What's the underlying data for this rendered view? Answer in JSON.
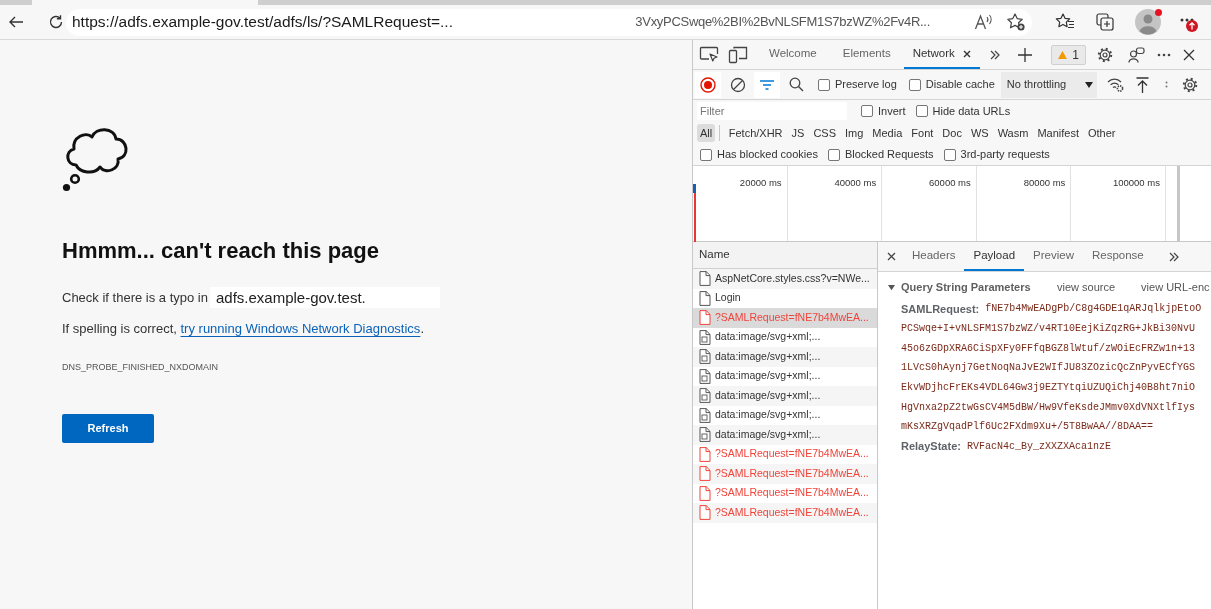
{
  "browser": {
    "url": "https://adfs.example-gov.test/adfs/ls/?SAMLRequest=...",
    "url_tail": "3VxyPCSwqe%2BI%2BvNLSFM1S7bzWZ%2Fv4R..."
  },
  "error_page": {
    "heading": "Hmmm... can't reach this page",
    "typo_hint": "Check if there is a typo in",
    "domain": "adfs.example-gov.test.",
    "spelling_hint": {
      "text": "If spelling is correct,",
      "link": "try running Windows Network Diagnostics",
      "end": "."
    },
    "error_code": "DNS_PROBE_FINISHED_NXDOMAIN",
    "refresh_button": "Refresh"
  },
  "devtools": {
    "tabs": [
      {
        "label": "Welcome",
        "selected": false
      },
      {
        "label": "Elements",
        "selected": false
      },
      {
        "label": "Network",
        "selected": true
      }
    ],
    "warning_count": "1",
    "toolbar": {
      "recording": true,
      "filter_bar_open": true,
      "checkboxes": [
        {
          "label": "Preserve log",
          "checked": false
        },
        {
          "label": "Disable cache",
          "checked": false
        }
      ],
      "throttling": "No throttling"
    },
    "filter": {
      "placeholder": "Filter",
      "options": [
        {
          "label": "Invert",
          "checked": false
        },
        {
          "label": "Hide data URLs",
          "checked": false
        }
      ]
    },
    "type_filters": [
      {
        "label": "All",
        "selected": true
      },
      {
        "label": "Fetch/XHR",
        "selected": false
      },
      {
        "label": "JS",
        "selected": false
      },
      {
        "label": "CSS",
        "selected": false
      },
      {
        "label": "Img",
        "selected": false
      },
      {
        "label": "Media",
        "selected": false
      },
      {
        "label": "Font",
        "selected": false
      },
      {
        "label": "Doc",
        "selected": false
      },
      {
        "label": "WS",
        "selected": false
      },
      {
        "label": "Wasm",
        "selected": false
      },
      {
        "label": "Manifest",
        "selected": false
      },
      {
        "label": "Other",
        "selected": false
      }
    ],
    "request_filters": [
      {
        "label": "Has blocked cookies",
        "checked": false
      },
      {
        "label": "Blocked Requests",
        "checked": false
      },
      {
        "label": "3rd-party requests",
        "checked": false
      }
    ],
    "timeline": {
      "ticks": [
        "20000 ms",
        "40000 ms",
        "60000 ms",
        "80000 ms",
        "100000 ms"
      ]
    },
    "requests": {
      "column": "Name",
      "rows": [
        {
          "name": "AspNetCore.styles.css?v=NWe...",
          "kind": "document",
          "failed": false,
          "selected": false
        },
        {
          "name": "Login",
          "kind": "document",
          "failed": false,
          "selected": false
        },
        {
          "name": "?SAMLRequest=fNE7b4MwEA...",
          "kind": "document",
          "failed": true,
          "selected": true
        },
        {
          "name": "data:image/svg+xml;...",
          "kind": "image",
          "failed": false,
          "selected": false
        },
        {
          "name": "data:image/svg+xml;...",
          "kind": "image",
          "failed": false,
          "selected": false
        },
        {
          "name": "data:image/svg+xml;...",
          "kind": "image",
          "failed": false,
          "selected": false
        },
        {
          "name": "data:image/svg+xml;...",
          "kind": "image",
          "failed": false,
          "selected": false
        },
        {
          "name": "data:image/svg+xml;...",
          "kind": "image",
          "failed": false,
          "selected": false
        },
        {
          "name": "data:image/svg+xml;...",
          "kind": "image",
          "failed": false,
          "selected": false
        },
        {
          "name": "?SAMLRequest=fNE7b4MwEA...",
          "kind": "document",
          "failed": true,
          "selected": false
        },
        {
          "name": "?SAMLRequest=fNE7b4MwEA...",
          "kind": "document",
          "failed": true,
          "selected": false
        },
        {
          "name": "?SAMLRequest=fNE7b4MwEA...",
          "kind": "document",
          "failed": true,
          "selected": false
        },
        {
          "name": "?SAMLRequest=fNE7b4MwEA...",
          "kind": "document",
          "failed": true,
          "selected": false
        }
      ]
    },
    "details": {
      "tabs": [
        {
          "label": "Headers",
          "selected": false
        },
        {
          "label": "Payload",
          "selected": true
        },
        {
          "label": "Preview",
          "selected": false
        },
        {
          "label": "Response",
          "selected": false
        }
      ],
      "section": {
        "title": "Query String Parameters",
        "expanded": true,
        "view_source": "view source",
        "view_url_encoded": "view URL-enc"
      },
      "params": [
        {
          "key": "SAMLRequest:",
          "lines": [
            "fNE7b4MwEADgPb/C8g4GDE1qARJqlkjpEtoO",
            "PCSwqe+I+vNLSFM1S7bzWZ/v4RT10EejKiZqzRG+JkBi30NvU",
            "45o6zGDpXRA6CiSpXFy0FFfqBGZ8lWtuf/zWOiEcFRZw1n+13",
            "1LVcS0hAynj7GetNoqNaJvE2WIfJU83ZOzicQcZnPyvECfYGS",
            "EkvWDjhcFrEKs4VDL64Gw3j9EZTYtqiUZUQiChj40B8ht7niO",
            "HgVnxa2pZ2twGsCV4M5dBW/Hw9VfeKsdeJMmv0XdVNXtlfIys",
            "mKsXRZgVqadPlf6Uc2FXdm9Xu+/5T8BwAA//8DAA=="
          ]
        },
        {
          "key": "RelayState:",
          "lines": [
            "RVFacN4c_By_zXXZXAca1nzE"
          ]
        }
      ]
    }
  }
}
